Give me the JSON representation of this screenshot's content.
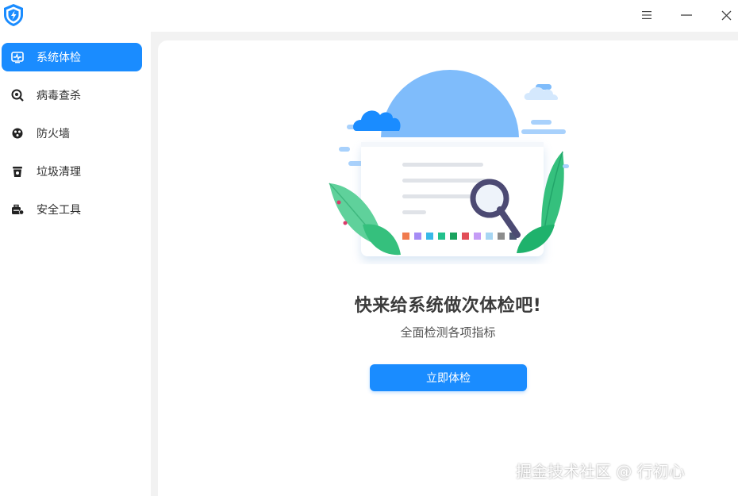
{
  "sidebar": {
    "items": [
      {
        "label": "系统体检",
        "icon": "heartbeat-monitor-icon",
        "active": true
      },
      {
        "label": "病毒查杀",
        "icon": "virus-scan-icon",
        "active": false
      },
      {
        "label": "防火墙",
        "icon": "firewall-icon",
        "active": false
      },
      {
        "label": "垃圾清理",
        "icon": "trash-clean-icon",
        "active": false
      },
      {
        "label": "安全工具",
        "icon": "toolbox-icon",
        "active": false
      }
    ]
  },
  "titlebar": {
    "icons": [
      "shield-logo-icon",
      "menu-icon",
      "minimize-icon",
      "close-icon"
    ]
  },
  "main": {
    "headline": "快来给系统做次体检吧!",
    "subline": "全面检测各项指标",
    "button_label": "立即体检"
  },
  "watermark": "掘金技术社区 @ 行初心",
  "colors": {
    "accent": "#1a8cff",
    "sidebar_bg": "#ffffff",
    "page_bg": "#f2f2f2"
  }
}
